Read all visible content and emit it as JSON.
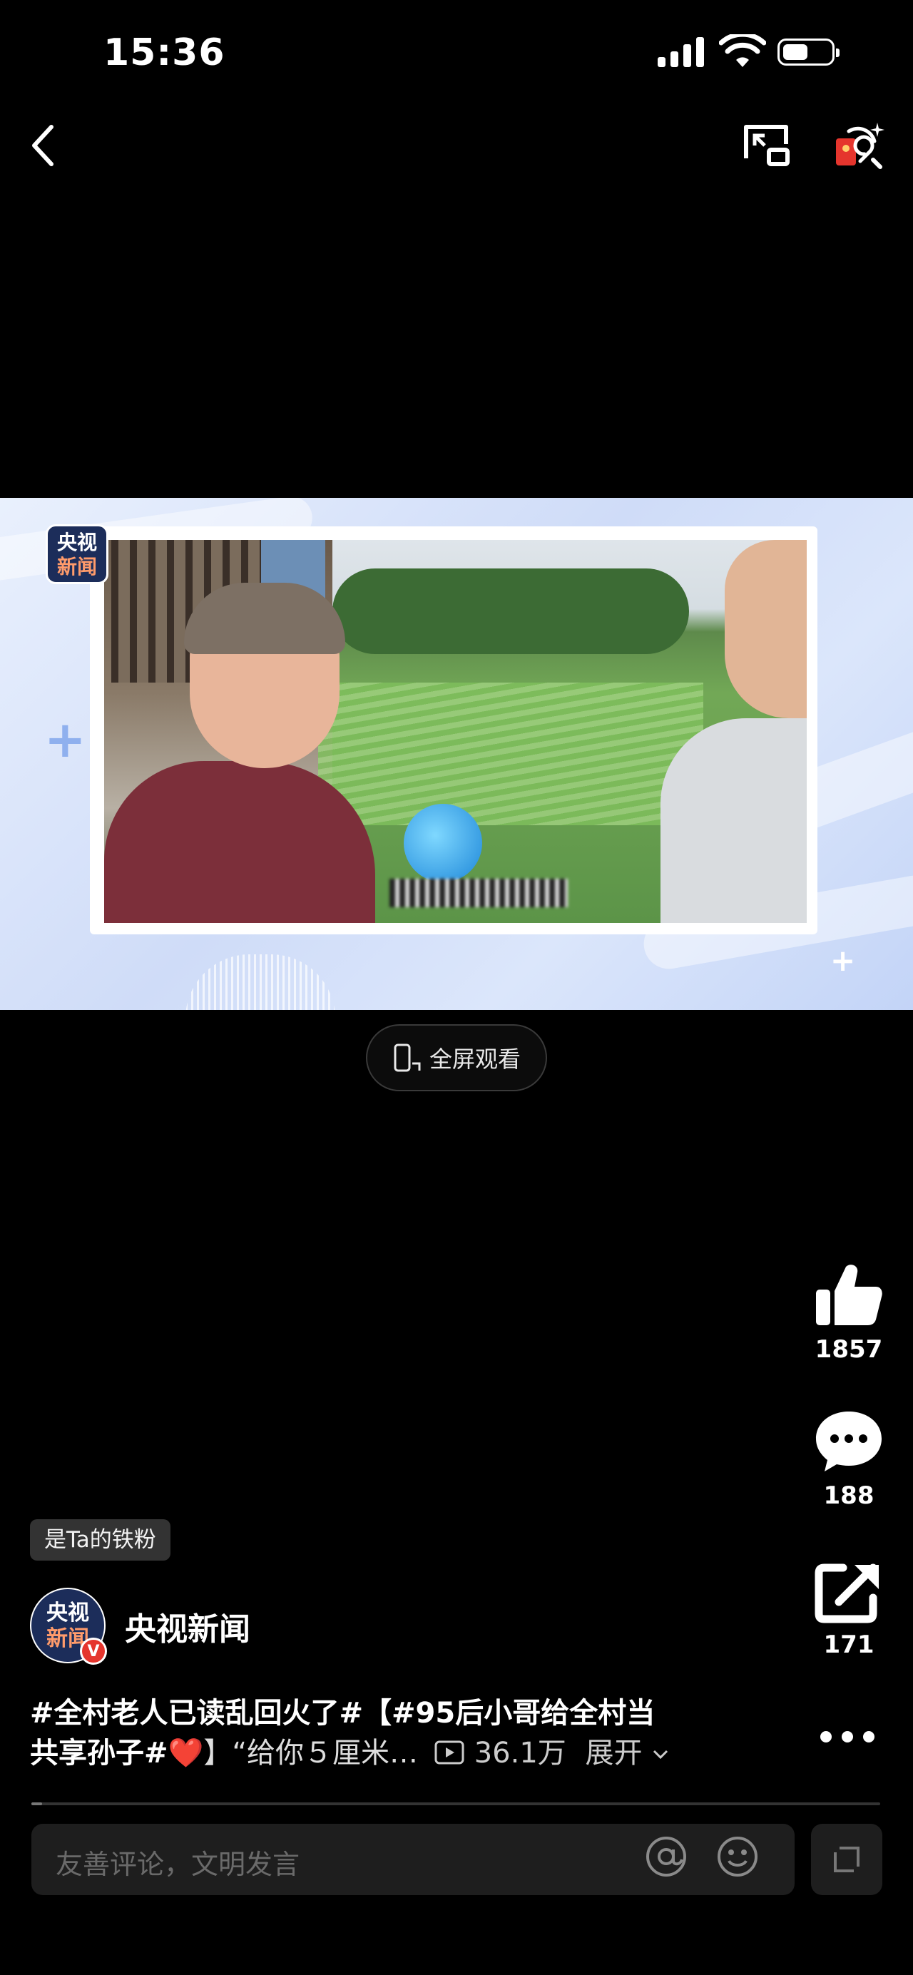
{
  "status_bar": {
    "time": "15:36"
  },
  "nav": {
    "back_icon": "chevron-left-icon",
    "pip_icon": "picture-in-picture-icon",
    "redpacket_icon": "red-packet-search-icon"
  },
  "video": {
    "channel_badge_line1": "央视",
    "channel_badge_line2": "新闻",
    "fullscreen_label": "全屏观看"
  },
  "rail": {
    "likes": "1857",
    "comments": "188",
    "shares": "171"
  },
  "fan_badge": "是Ta的铁粉",
  "author": {
    "avatar_line1": "央视",
    "avatar_line2": "新闻",
    "verified": "V",
    "name": "央视新闻"
  },
  "caption": {
    "line1": "#全村老人已读乱回火了#【#95后小哥给全村当",
    "line2_prefix": "共享孙子#",
    "line2_heart": "❤️",
    "line2_rest": "】“给你５厘米…",
    "views": "36.1万",
    "expand": "展开"
  },
  "playback_progress": 0.013,
  "comment": {
    "placeholder": "友善评论，文明发言"
  },
  "colors": {
    "accent_red": "#e5352d",
    "video_bg": "#d5e1fa"
  }
}
